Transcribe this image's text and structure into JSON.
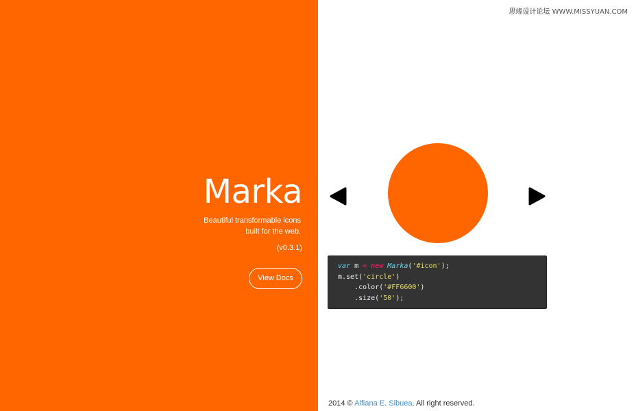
{
  "watermark": {
    "text": "思缘设计论坛 WWW.MISSYUAN.COM"
  },
  "hero": {
    "title": "Marka",
    "tagline_line1": "Beautiful transformable icons",
    "tagline_line2": "built for the web.",
    "version": "(v0.3.1)",
    "view_docs_label": "View Docs"
  },
  "demo": {
    "prev_icon": "triangle-left-icon",
    "next_icon": "triangle-right-icon",
    "current_icon": "circle",
    "icon_color": "#FF6600"
  },
  "code": {
    "l1_kw": "var",
    "l1_name": " m ",
    "l1_op": "=",
    "l1_sp": " ",
    "l1_new": "new",
    "l1_sp2": " ",
    "l1_cls": "Marka",
    "l1_open": "(",
    "l1_str": "'#icon'",
    "l1_close": ");",
    "l2_pre": "m.set(",
    "l2_str": "'circle'",
    "l2_post": ")",
    "l3_pre": "    .color(",
    "l3_str": "'#FF6600'",
    "l3_post": ")",
    "l4_pre": "    .size(",
    "l4_str": "'50'",
    "l4_post": ");"
  },
  "footer": {
    "prefix": "2014 © ",
    "author": "Alfiana E. Sibuea",
    "suffix": ". All right reserved."
  },
  "colors": {
    "brand_orange": "#ff6600",
    "code_bg": "#333333",
    "link": "#3d8fd1"
  }
}
